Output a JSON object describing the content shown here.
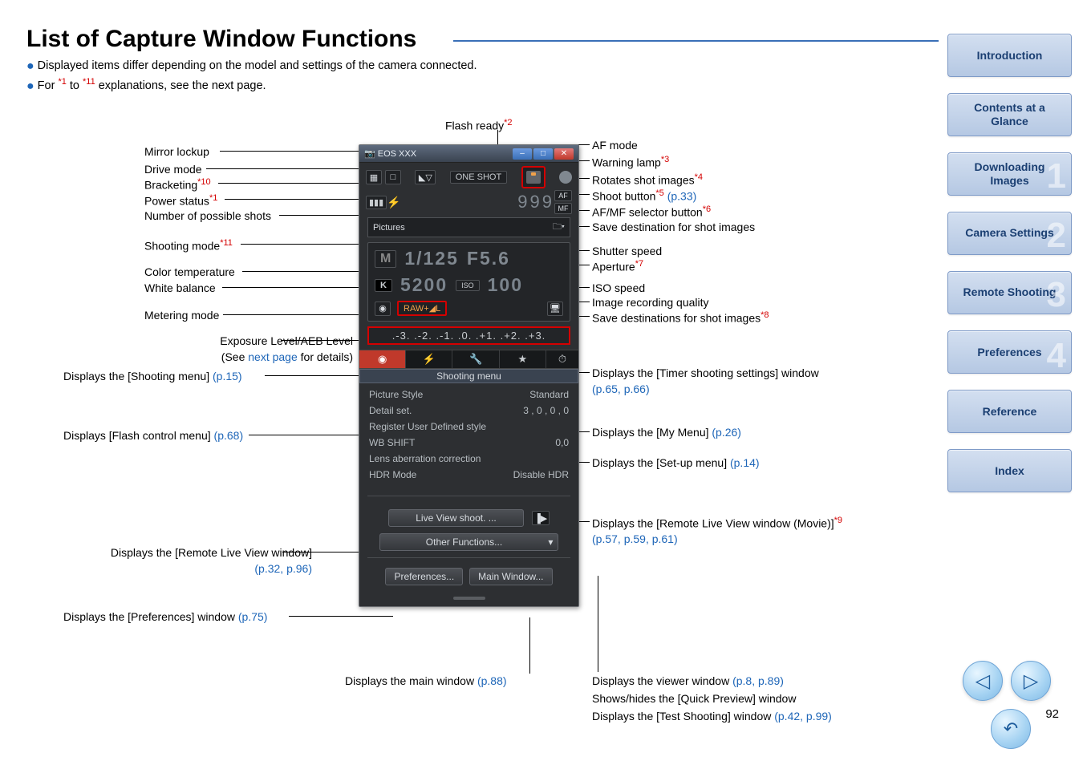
{
  "page": {
    "title": "List of Capture Window Functions",
    "note1_prefix": "Displayed items differ depending on the model and settings of the camera connected.",
    "note2_a": "For ",
    "note2_s1": "*1",
    "note2_b": " to ",
    "note2_s2": "*11",
    "note2_c": " explanations,  see the next page.",
    "number": "92"
  },
  "sidebar": {
    "items": [
      {
        "label": "Introduction",
        "ghost": ""
      },
      {
        "label": "Contents at a Glance",
        "ghost": ""
      },
      {
        "label": "Downloading Images",
        "ghost": "1"
      },
      {
        "label": "Camera Settings",
        "ghost": "2"
      },
      {
        "label": "Remote Shooting",
        "ghost": "3"
      },
      {
        "label": "Preferences",
        "ghost": "4"
      },
      {
        "label": "Reference",
        "ghost": ""
      },
      {
        "label": "Index",
        "ghost": ""
      }
    ]
  },
  "left_labels": {
    "flash_ready": "Flash ready",
    "flash_ready_sup": "*2",
    "mirror_lockup": "Mirror lockup",
    "drive_mode": "Drive mode",
    "bracketing": "Bracketing",
    "bracketing_sup": "*10",
    "power_status": "Power status",
    "power_status_sup": "*1",
    "possible_shots": "Number of possible shots",
    "shooting_mode": "Shooting mode",
    "shooting_mode_sup": "*11",
    "color_temp": "Color temperature",
    "white_balance": "White balance",
    "metering_mode": "Metering mode",
    "exposure_a": "Exposure Level/AEB Level",
    "exposure_b_pre": "(See ",
    "exposure_b_link": "next page",
    "exposure_b_post": " for details)",
    "shooting_menu": "Displays the [Shooting menu] ",
    "shooting_menu_link": "(p.15)",
    "flash_ctrl": "Displays [Flash control menu] ",
    "flash_ctrl_link": "(p.68)",
    "rlv": "Displays the [Remote Live View window]",
    "rlv_link": "(p.32, p.96)",
    "prefs": "Displays the [Preferences] window ",
    "prefs_link": "(p.75)",
    "mainwin": "Displays the main window ",
    "mainwin_link": "(p.88)"
  },
  "right_labels": {
    "af_mode": "AF mode",
    "warning_lamp": "Warning lamp",
    "warning_lamp_sup": "*3",
    "rotates": "Rotates shot images",
    "rotates_sup": "*4",
    "shoot": "Shoot button",
    "shoot_sup": "*5",
    "shoot_link": " (p.33)",
    "afmf": "AF/MF selector button",
    "afmf_sup": "*6",
    "save_dest": "Save destination for shot images",
    "shutter_speed": "Shutter speed",
    "aperture": "Aperture",
    "aperture_sup": "*7",
    "iso": "ISO speed",
    "img_quality": "Image recording quality",
    "save_dests": "Save destinations for shot images",
    "save_dests_sup": "*8",
    "timer": "Displays the [Timer shooting settings] window",
    "timer_link": "(p.65, p.66)",
    "mymenu": "Displays the [My Menu] ",
    "mymenu_link": "(p.26)",
    "setup": "Displays the [Set-up menu] ",
    "setup_link": "(p.14)",
    "rlv_movie": "Displays the [Remote Live View window (Movie)]",
    "rlv_movie_sup": "*9",
    "rlv_movie_link": "(p.57, p.59, p.61)",
    "viewer": "Displays the viewer window ",
    "viewer_link": "(p.8, p.89)",
    "quick": "Shows/hides the [Quick Preview] window",
    "test": "Displays the [Test Shooting] window ",
    "test_link": "(p.42, p.99)"
  },
  "capwin": {
    "title": "EOS XXX",
    "one_shot": "ONE SHOT",
    "af": "AF",
    "mf": "MF",
    "counter": "999",
    "pictures": "Pictures",
    "mode": "M",
    "shutter": "1/125",
    "fnum": "F5.6",
    "wb": "K",
    "kelvin": "5200",
    "iso_label": "ISO",
    "iso": "100",
    "raw": "RAW+",
    "raw2": "◢L",
    "scale": ".-3. .-2. .-1. .0. .+1. .+2. .+3.",
    "tablabel": "Shooting menu",
    "menu": [
      {
        "l": "Picture Style",
        "r": "Standard"
      },
      {
        "l": "Detail set.",
        "r": "3 , 0 , 0 , 0"
      },
      {
        "l": "Register User Defined style",
        "r": ""
      },
      {
        "l": "WB SHIFT",
        "r": "0,0"
      },
      {
        "l": "Lens aberration correction",
        "r": ""
      },
      {
        "l": "HDR Mode",
        "r": "Disable HDR"
      }
    ],
    "live_view": "Live View shoot. ...",
    "other_fn": "Other Functions...",
    "prefs_btn": "Preferences...",
    "mainwin_btn": "Main Window..."
  },
  "nav": {
    "prev": "◁",
    "next": "▷",
    "back": "↶"
  }
}
